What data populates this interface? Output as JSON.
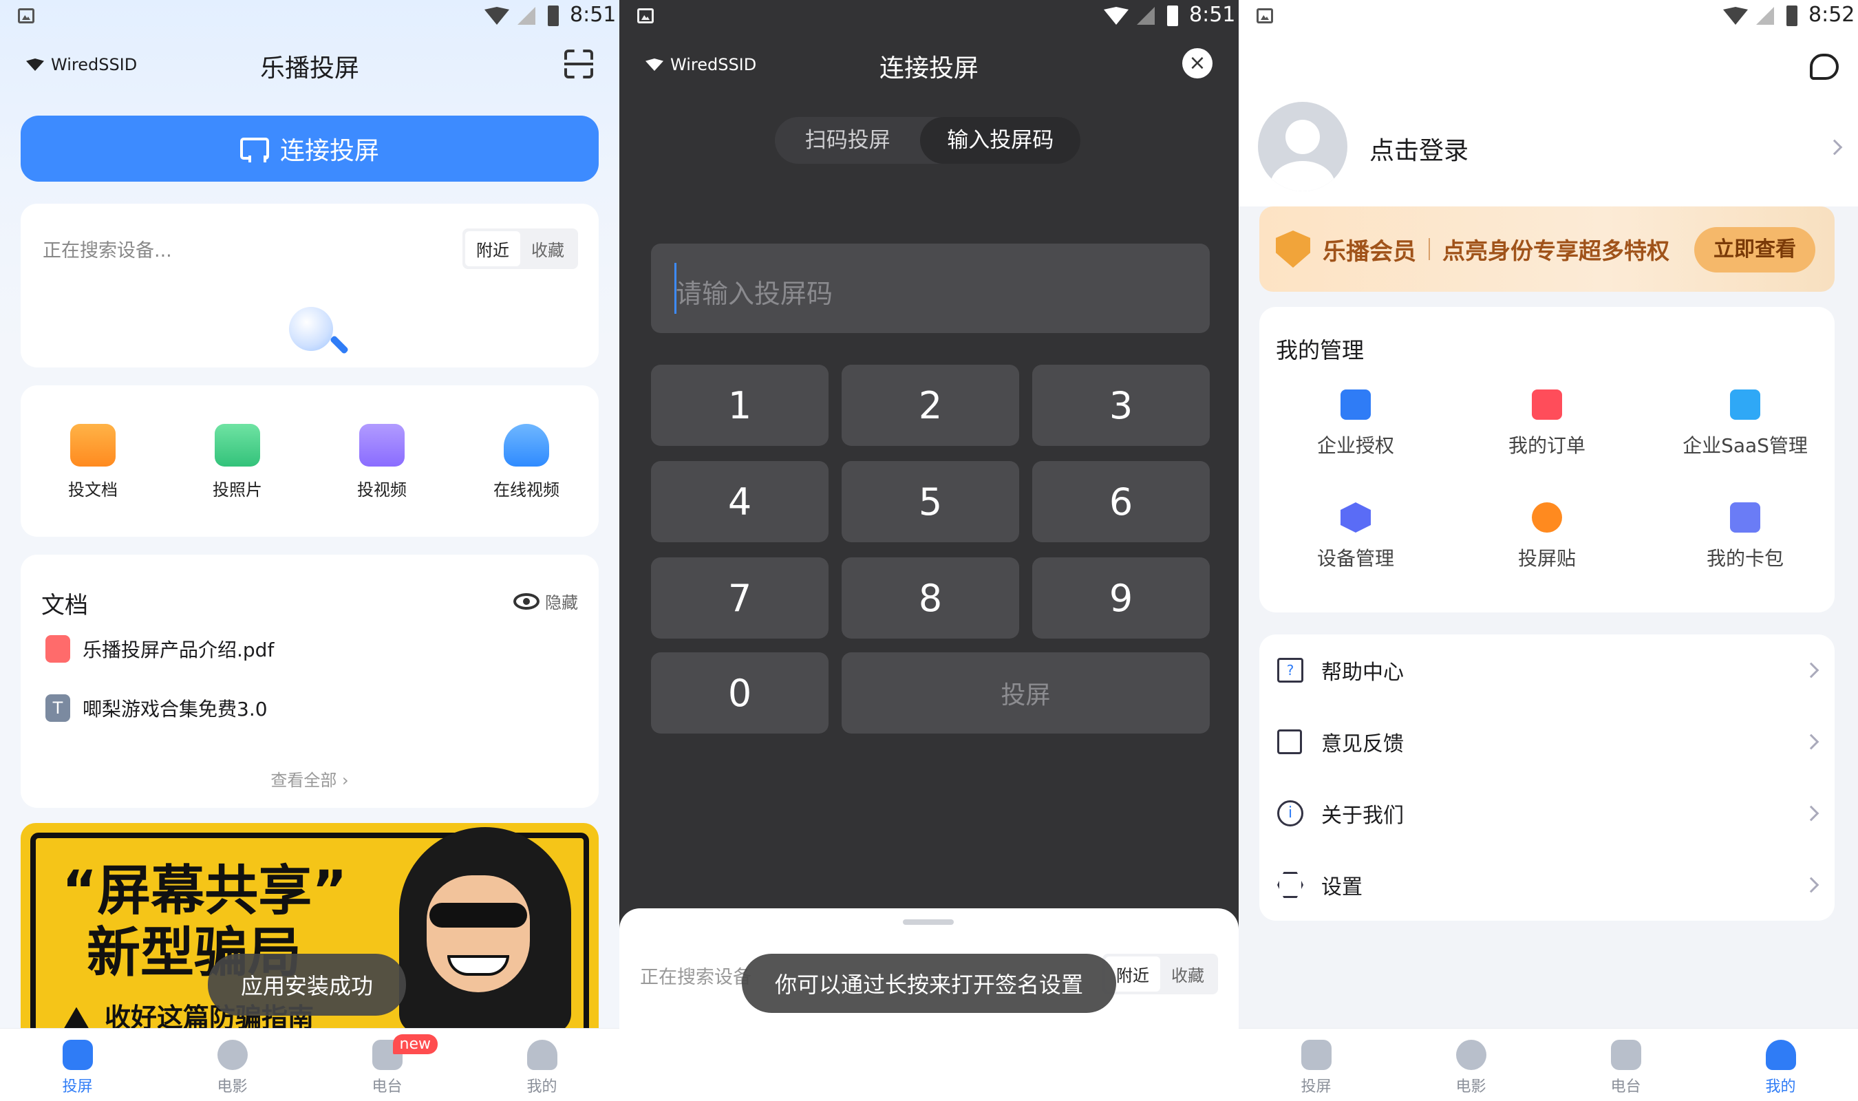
{
  "screen1": {
    "status": {
      "time": "8:51"
    },
    "ssid": "WiredSSID",
    "title": "乐播投屏",
    "connect_label": "连接投屏",
    "search_text": "正在搜索设备...",
    "seg_nearby": "附近",
    "seg_fav": "收藏",
    "features": [
      {
        "label": "投文档",
        "icon": "document-icon",
        "color": "#ff8a1f"
      },
      {
        "label": "投照片",
        "icon": "photo-icon",
        "color": "#33c27a"
      },
      {
        "label": "投视频",
        "icon": "video-icon",
        "color": "#8a6cff"
      },
      {
        "label": "在线视频",
        "icon": "cloud-play-icon",
        "color": "#2f8bff"
      }
    ],
    "docs": {
      "title": "文档",
      "hide_label": "隐藏",
      "items": [
        {
          "name": "乐播投屏产品介绍.pdf",
          "icon": "pdf-icon",
          "color": "#ff6b6b"
        },
        {
          "name": "唧梨游戏合集免费3.0",
          "icon": "text-file-icon",
          "color": "#7b8aa0"
        }
      ],
      "view_all": "查看全部 ›"
    },
    "banner": {
      "line1": "“屏幕共享”",
      "line2": "新型骗局",
      "line3": "收好这篇防骗指南"
    },
    "toast": "应用安装成功",
    "tabs": [
      {
        "label": "投屏",
        "active": true
      },
      {
        "label": "电影",
        "active": false
      },
      {
        "label": "电台",
        "active": false,
        "badge": "new"
      },
      {
        "label": "我的",
        "active": false
      }
    ]
  },
  "screen2": {
    "status": {
      "time": "8:51"
    },
    "ssid": "WiredSSID",
    "title": "连接投屏",
    "tab_scan": "扫码投屏",
    "tab_code": "输入投屏码",
    "placeholder": "请输入投屏码",
    "keys": [
      "1",
      "2",
      "3",
      "4",
      "5",
      "6",
      "7",
      "8",
      "9",
      "0"
    ],
    "cast_key": "投屏",
    "search_text": "正在搜索设备",
    "seg_nearby": "附近",
    "seg_fav": "收藏",
    "toast": "你可以通过长按来打开签名设置"
  },
  "screen3": {
    "status": {
      "time": "8:52"
    },
    "login": "点击登录",
    "vip_brand": "乐播会员",
    "vip_text": "点亮身份专享超多特权",
    "vip_button": "立即查看",
    "manage_title": "我的管理",
    "manage_items": [
      {
        "label": "企业授权",
        "icon": "briefcase-icon",
        "color": "#2f7cf6"
      },
      {
        "label": "我的订单",
        "icon": "order-icon",
        "color": "#ff4d5a"
      },
      {
        "label": "企业SaaS管理",
        "icon": "saas-file-icon",
        "color": "#2fa8f6"
      },
      {
        "label": "设备管理",
        "icon": "device-hex-icon",
        "color": "#5a6cf6"
      },
      {
        "label": "投屏贴",
        "icon": "nfc-icon",
        "color": "#ff8a1f"
      },
      {
        "label": "我的卡包",
        "icon": "wallet-icon",
        "color": "#6a7cf6"
      }
    ],
    "menu": [
      {
        "label": "帮助中心",
        "icon": "help-icon"
      },
      {
        "label": "意见反馈",
        "icon": "feedback-icon"
      },
      {
        "label": "关于我们",
        "icon": "info-icon"
      },
      {
        "label": "设置",
        "icon": "settings-icon"
      }
    ],
    "tabs": [
      {
        "label": "投屏",
        "active": false
      },
      {
        "label": "电影",
        "active": false
      },
      {
        "label": "电台",
        "active": false
      },
      {
        "label": "我的",
        "active": true
      }
    ]
  }
}
